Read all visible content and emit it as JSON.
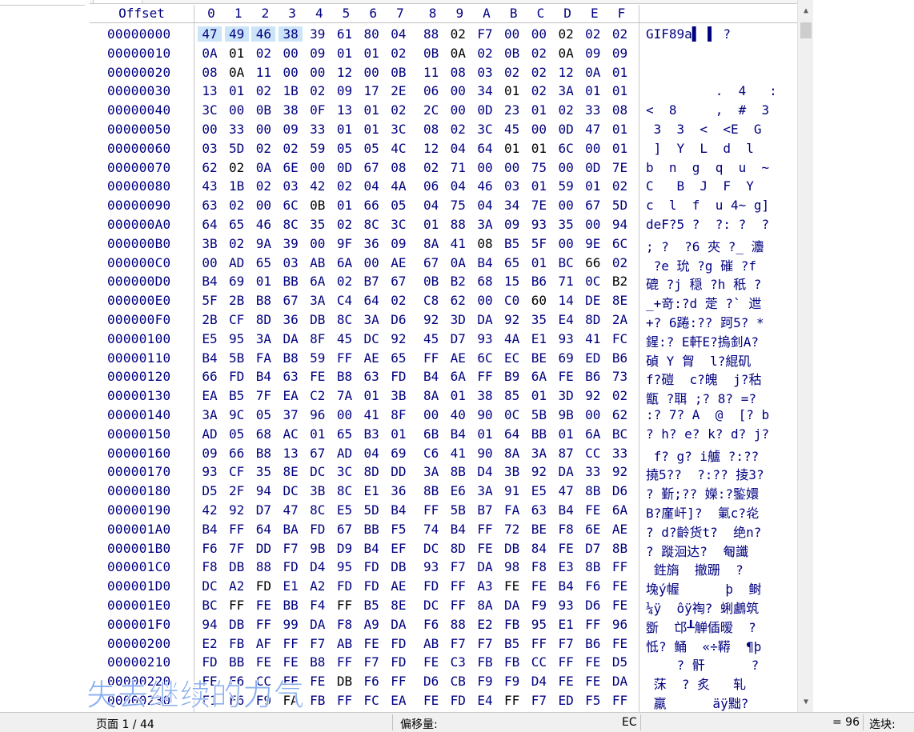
{
  "header": {
    "offset_label": "Offset",
    "columns": [
      "0",
      "1",
      "2",
      "3",
      "4",
      "5",
      "6",
      "7",
      "8",
      "9",
      "A",
      "B",
      "C",
      "D",
      "E",
      "F"
    ]
  },
  "rows": [
    {
      "offset": "00000000",
      "bytes": [
        "47",
        "49",
        "46",
        "38",
        "39",
        "61",
        "80",
        "04",
        "88",
        "02",
        "F7",
        "00",
        "00",
        "02",
        "02",
        "02"
      ],
      "text": "GIF89a▌ ▌ ?"
    },
    {
      "offset": "00000010",
      "bytes": [
        "0A",
        "01",
        "02",
        "00",
        "09",
        "01",
        "01",
        "02",
        "0B",
        "0A",
        "02",
        "0B",
        "02",
        "0A",
        "09",
        "09"
      ],
      "text": ""
    },
    {
      "offset": "00000020",
      "bytes": [
        "08",
        "0A",
        "11",
        "00",
        "00",
        "12",
        "00",
        "0B",
        "11",
        "08",
        "03",
        "02",
        "02",
        "12",
        "0A",
        "01"
      ],
      "text": ""
    },
    {
      "offset": "00000030",
      "bytes": [
        "13",
        "01",
        "02",
        "1B",
        "02",
        "09",
        "17",
        "2E",
        "06",
        "00",
        "34",
        "01",
        "02",
        "3A",
        "01",
        "01"
      ],
      "text": "         .  4   :"
    },
    {
      "offset": "00000040",
      "bytes": [
        "3C",
        "00",
        "0B",
        "38",
        "0F",
        "13",
        "01",
        "02",
        "2C",
        "00",
        "0D",
        "23",
        "01",
        "02",
        "33",
        "08"
      ],
      "text": "<  8     ,  #  3"
    },
    {
      "offset": "00000050",
      "bytes": [
        "00",
        "33",
        "00",
        "09",
        "33",
        "01",
        "01",
        "3C",
        "08",
        "02",
        "3C",
        "45",
        "00",
        "0D",
        "47",
        "01"
      ],
      "text": " 3  3  <  <E  G"
    },
    {
      "offset": "00000060",
      "bytes": [
        "03",
        "5D",
        "02",
        "02",
        "59",
        "05",
        "05",
        "4C",
        "12",
        "04",
        "64",
        "01",
        "01",
        "6C",
        "00",
        "01"
      ],
      "text": " ]  Y  L  d  l"
    },
    {
      "offset": "00000070",
      "bytes": [
        "62",
        "02",
        "0A",
        "6E",
        "00",
        "0D",
        "67",
        "08",
        "02",
        "71",
        "00",
        "00",
        "75",
        "00",
        "0D",
        "7E"
      ],
      "text": "b  n  g  q  u  ~"
    },
    {
      "offset": "00000080",
      "bytes": [
        "43",
        "1B",
        "02",
        "03",
        "42",
        "02",
        "04",
        "4A",
        "06",
        "04",
        "46",
        "03",
        "01",
        "59",
        "01",
        "02"
      ],
      "text": "C   B  J  F  Y"
    },
    {
      "offset": "00000090",
      "bytes": [
        "63",
        "02",
        "00",
        "6C",
        "0B",
        "01",
        "66",
        "05",
        "04",
        "75",
        "04",
        "34",
        "7E",
        "00",
        "67",
        "5D"
      ],
      "text": "c  l  f  u 4~ g]"
    },
    {
      "offset": "000000A0",
      "bytes": [
        "64",
        "65",
        "46",
        "8C",
        "35",
        "02",
        "8C",
        "3C",
        "01",
        "88",
        "3A",
        "09",
        "93",
        "35",
        "00",
        "94"
      ],
      "text": "deF?5 ?  ?: ?  ?"
    },
    {
      "offset": "000000B0",
      "bytes": [
        "3B",
        "02",
        "9A",
        "39",
        "00",
        "9F",
        "36",
        "09",
        "8A",
        "41",
        "08",
        "B5",
        "5F",
        "00",
        "9E",
        "6C"
      ],
      "text": "; ?  ?6 夾 ?_ 灋"
    },
    {
      "offset": "000000C0",
      "bytes": [
        "00",
        "AD",
        "65",
        "03",
        "AB",
        "6A",
        "00",
        "AE",
        "67",
        "0A",
        "B4",
        "65",
        "01",
        "BC",
        "66",
        "02"
      ],
      "text": " ?e 玧 ?g 磪 ?f"
    },
    {
      "offset": "000000D0",
      "bytes": [
        "B4",
        "69",
        "01",
        "BB",
        "6A",
        "02",
        "B7",
        "67",
        "0B",
        "B2",
        "68",
        "15",
        "B6",
        "71",
        "0C",
        "B2"
      ],
      "text": "磇 ?j 穏 ?h 秖 ?"
    },
    {
      "offset": "000000E0",
      "bytes": [
        "5F",
        "2B",
        "B8",
        "67",
        "3A",
        "C4",
        "64",
        "02",
        "C8",
        "62",
        "00",
        "C0",
        "60",
        "14",
        "DE",
        "8E"
      ],
      "text": "_+竒:?d 萣 ?` 迣"
    },
    {
      "offset": "000000F0",
      "bytes": [
        "2B",
        "CF",
        "8D",
        "36",
        "DB",
        "8C",
        "3A",
        "D6",
        "92",
        "3D",
        "DA",
        "92",
        "35",
        "E4",
        "8D",
        "2A"
      ],
      "text": "+? 6踡:?? 跒5? *"
    },
    {
      "offset": "00000100",
      "bytes": [
        "E5",
        "95",
        "3A",
        "DA",
        "8F",
        "45",
        "DC",
        "92",
        "45",
        "D7",
        "93",
        "4A",
        "E1",
        "93",
        "41",
        "FC"
      ],
      "text": "鍟:? E軒E?摀釗A?"
    },
    {
      "offset": "00000110",
      "bytes": [
        "B4",
        "5B",
        "FA",
        "B8",
        "59",
        "FF",
        "AE",
        "65",
        "FF",
        "AE",
        "6C",
        "EC",
        "BE",
        "69",
        "ED",
        "B6"
      ],
      "text": "碵 Y 胷  l?緄矶"
    },
    {
      "offset": "00000120",
      "bytes": [
        "66",
        "FD",
        "B4",
        "63",
        "FE",
        "B8",
        "63",
        "FD",
        "B4",
        "6A",
        "FF",
        "B9",
        "6A",
        "FE",
        "B6",
        "73"
      ],
      "text": "f?磑  c?魄  j?秙"
    },
    {
      "offset": "00000130",
      "bytes": [
        "EA",
        "B5",
        "7F",
        "EA",
        "C2",
        "7A",
        "01",
        "3B",
        "8A",
        "01",
        "38",
        "85",
        "01",
        "3D",
        "92",
        "02"
      ],
      "text": "甑 ?聑 ;? 8? =?"
    },
    {
      "offset": "00000140",
      "bytes": [
        "3A",
        "9C",
        "05",
        "37",
        "96",
        "00",
        "41",
        "8F",
        "00",
        "40",
        "90",
        "0C",
        "5B",
        "9B",
        "00",
        "62"
      ],
      "text": ":? 7? A  @  [? b"
    },
    {
      "offset": "00000150",
      "bytes": [
        "AD",
        "05",
        "68",
        "AC",
        "01",
        "65",
        "B3",
        "01",
        "6B",
        "B4",
        "01",
        "64",
        "BB",
        "01",
        "6A",
        "BC"
      ],
      "text": "? h? e? k? d? j?"
    },
    {
      "offset": "00000160",
      "bytes": [
        "09",
        "66",
        "B8",
        "13",
        "67",
        "AD",
        "04",
        "69",
        "C6",
        "41",
        "90",
        "8A",
        "3A",
        "87",
        "CC",
        "33"
      ],
      "text": " f? g? i艫 ?:??"
    },
    {
      "offset": "00000170",
      "bytes": [
        "93",
        "CF",
        "35",
        "8E",
        "DC",
        "3C",
        "8D",
        "DD",
        "3A",
        "8B",
        "D4",
        "3B",
        "92",
        "DA",
        "33",
        "92"
      ],
      "text": "撓5??  ?:?? 掕3?"
    },
    {
      "offset": "00000180",
      "bytes": [
        "D5",
        "2F",
        "94",
        "DC",
        "3B",
        "8C",
        "E1",
        "36",
        "8B",
        "E6",
        "3A",
        "91",
        "E5",
        "47",
        "8B",
        "D6"
      ],
      "text": "? 斳;?? 嬫:?鍳嬛"
    },
    {
      "offset": "00000190",
      "bytes": [
        "42",
        "92",
        "D7",
        "47",
        "8C",
        "E5",
        "5D",
        "B4",
        "FF",
        "5B",
        "B7",
        "FA",
        "63",
        "B4",
        "FE",
        "6A"
      ],
      "text": "B?廑屽]?  氭c?炛"
    },
    {
      "offset": "000001A0",
      "bytes": [
        "B4",
        "FF",
        "64",
        "BA",
        "FD",
        "67",
        "BB",
        "F5",
        "74",
        "B4",
        "FF",
        "72",
        "BE",
        "F8",
        "6E",
        "AE"
      ],
      "text": "? d?齡货t?  绝n?"
    },
    {
      "offset": "000001B0",
      "bytes": [
        "F6",
        "7F",
        "DD",
        "F7",
        "9B",
        "D9",
        "B4",
        "EF",
        "DC",
        "8D",
        "FE",
        "DB",
        "84",
        "FE",
        "D7",
        "8B"
      ],
      "text": "? 蹝洄达?  匎讖"
    },
    {
      "offset": "000001C0",
      "bytes": [
        "F8",
        "DB",
        "88",
        "FD",
        "D4",
        "95",
        "FD",
        "DB",
        "93",
        "F7",
        "DA",
        "98",
        "F8",
        "E3",
        "8B",
        "FF"
      ],
      "text": " 鉎旓  撤跚  ?"
    },
    {
      "offset": "000001D0",
      "bytes": [
        "DC",
        "A2",
        "FD",
        "E1",
        "A2",
        "FD",
        "FD",
        "AE",
        "FD",
        "FF",
        "A3",
        "FE",
        "FE",
        "B4",
        "F6",
        "FE"
      ],
      "text": "堍ý幄      þ  鲥"
    },
    {
      "offset": "000001E0",
      "bytes": [
        "BC",
        "FF",
        "FE",
        "BB",
        "F4",
        "FF",
        "B5",
        "8E",
        "DC",
        "FF",
        "8A",
        "DA",
        "F9",
        "93",
        "D6",
        "FE"
      ],
      "text": "¼ÿ  ôÿ祹? 蜊鸕筑"
    },
    {
      "offset": "000001F0",
      "bytes": [
        "94",
        "DB",
        "FF",
        "99",
        "DA",
        "F8",
        "A9",
        "DA",
        "F6",
        "88",
        "E2",
        "FB",
        "95",
        "E1",
        "FF",
        "96"
      ],
      "text": "斵  邙┸觯偛暧  ?"
    },
    {
      "offset": "00000200",
      "bytes": [
        "E2",
        "FB",
        "AF",
        "FF",
        "F7",
        "AB",
        "FE",
        "FD",
        "AB",
        "F7",
        "F7",
        "B5",
        "FF",
        "F7",
        "B6",
        "FE"
      ],
      "text": "怟? 鲬  «÷鞯  ¶þ"
    },
    {
      "offset": "00000210",
      "bytes": [
        "FD",
        "BB",
        "FE",
        "FE",
        "B8",
        "FF",
        "F7",
        "FD",
        "FE",
        "C3",
        "FB",
        "FB",
        "CC",
        "FF",
        "FE",
        "D5"
      ],
      "text": "    ? 骭      ?"
    },
    {
      "offset": "00000220",
      "bytes": [
        "FE",
        "F6",
        "CC",
        "FE",
        "FE",
        "DB",
        "F6",
        "FF",
        "D6",
        "CB",
        "F9",
        "F9",
        "D4",
        "FE",
        "FE",
        "DA"
      ],
      "text": " 莯  ? 炙   轧"
    },
    {
      "offset": "00000230",
      "bytes": [
        "F1",
        "F6",
        "F9",
        "FA",
        "FB",
        "FF",
        "FC",
        "EA",
        "FE",
        "FD",
        "E4",
        "FF",
        "F7",
        "ED",
        "F5",
        "FF"
      ],
      "text": " 羸      äÿ黜?"
    }
  ],
  "selection": {
    "row": 0,
    "start": 0,
    "end": 3
  },
  "highlight_black": [
    {
      "row": 0,
      "col": 9
    },
    {
      "row": 0,
      "col": 13
    },
    {
      "row": 1,
      "col": 1
    },
    {
      "row": 1,
      "col": 9
    },
    {
      "row": 1,
      "col": 13
    },
    {
      "row": 2,
      "col": 1
    },
    {
      "row": 3,
      "col": 11
    },
    {
      "row": 6,
      "col": 11
    },
    {
      "row": 6,
      "col": 12
    },
    {
      "row": 7,
      "col": 1
    },
    {
      "row": 9,
      "col": 4
    },
    {
      "row": 11,
      "col": 10
    },
    {
      "row": 12,
      "col": 14
    },
    {
      "row": 13,
      "col": 15
    },
    {
      "row": 14,
      "col": 12
    },
    {
      "row": 29,
      "col": 2
    },
    {
      "row": 29,
      "col": 11
    },
    {
      "row": 30,
      "col": 1
    },
    {
      "row": 30,
      "col": 5
    },
    {
      "row": 34,
      "col": 5
    },
    {
      "row": 35,
      "col": 3
    },
    {
      "row": 35,
      "col": 11
    }
  ],
  "status": {
    "page": "页面 1 / 44",
    "offset_label": "偏移量:",
    "ec": "EC",
    "value": "= 96",
    "select_label": "选块:"
  },
  "overlay_subtitle": "失去继续的力气"
}
